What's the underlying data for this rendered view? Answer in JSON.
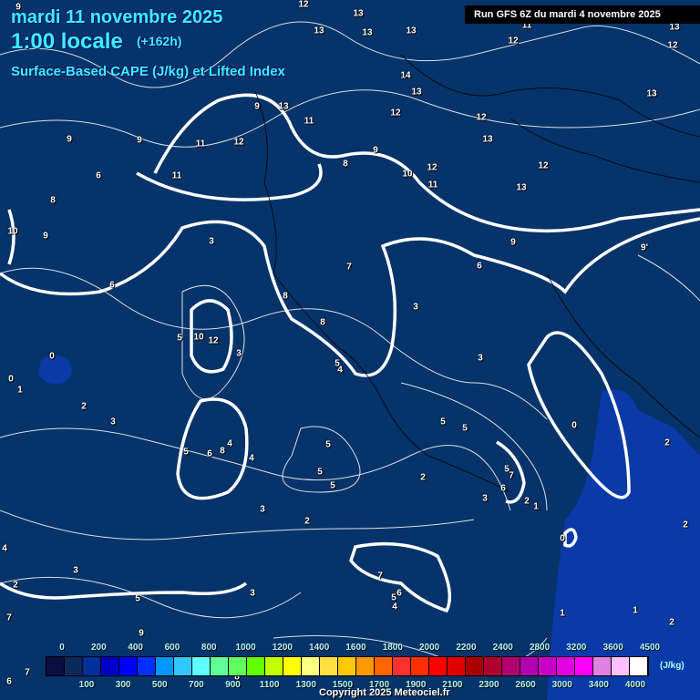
{
  "header": {
    "date": "mardi 11 novembre 2025",
    "time": "1:00 locale",
    "lead": "(+162h)",
    "parameter": "Surface-Based CAPE (J/kg) et Lifted Index",
    "run": "Run GFS 6Z du mardi 4 novembre 2025"
  },
  "contour_labels": [
    "9",
    "12",
    "13",
    "13",
    "13",
    "13",
    "11",
    "12",
    "13",
    "12",
    "14",
    "13",
    "13",
    "12",
    "12",
    "13",
    "11",
    "9",
    "11",
    "12",
    "9",
    "9",
    "13",
    "8",
    "9",
    "10",
    "12",
    "11",
    "12",
    "13",
    "6",
    "11",
    "8",
    "10",
    "9",
    "3",
    "9",
    "9'",
    "6",
    "6",
    "7",
    "8",
    "8",
    "3",
    "5",
    "10",
    "12",
    "3",
    "0",
    "3",
    "5",
    "4",
    "0",
    "1",
    "2",
    "3",
    "0",
    "5",
    "5",
    "2",
    "5",
    "6",
    "8",
    "4",
    "4",
    "5",
    "5",
    "5",
    "7",
    "5",
    "6",
    "2",
    "2",
    "1",
    "3",
    "3",
    "2",
    "2",
    "0",
    "4",
    "3",
    "2",
    "5",
    "3",
    "7",
    "6",
    "5",
    "4",
    "1",
    "1",
    "7",
    "2",
    "9",
    "8",
    "7",
    "6"
  ],
  "legend": {
    "colors": [
      "#0a0e40",
      "#0a2a5a",
      "#00309a",
      "#0000c8",
      "#0000ff",
      "#0030ff",
      "#0098ff",
      "#30c8ff",
      "#60ffff",
      "#60ff98",
      "#60ff60",
      "#60ff00",
      "#c0ff00",
      "#ffff00",
      "#ffff80",
      "#ffe040",
      "#ffc800",
      "#ff9800",
      "#ff6400",
      "#ff3030",
      "#ff3000",
      "#ff0000",
      "#e00000",
      "#a80000",
      "#b00030",
      "#b00070",
      "#b000b0",
      "#c800c8",
      "#e000e0",
      "#ff00ff",
      "#e080e0",
      "#ffc0ff",
      "#ffffff"
    ],
    "top_ticks": [
      "0",
      "200",
      "400",
      "600",
      "800",
      "1000",
      "1200",
      "1400",
      "1600",
      "1800",
      "2000",
      "2200",
      "2400",
      "2800",
      "3200",
      "3600",
      "4500"
    ],
    "bottom_ticks": [
      "100",
      "300",
      "500",
      "700",
      "900",
      "1100",
      "1300",
      "1500",
      "1700",
      "1900",
      "2100",
      "2300",
      "2600",
      "3000",
      "3400",
      "4000"
    ],
    "unit": "(J/kg)"
  },
  "copyright": "Copyright 2025 Meteociel.fr"
}
